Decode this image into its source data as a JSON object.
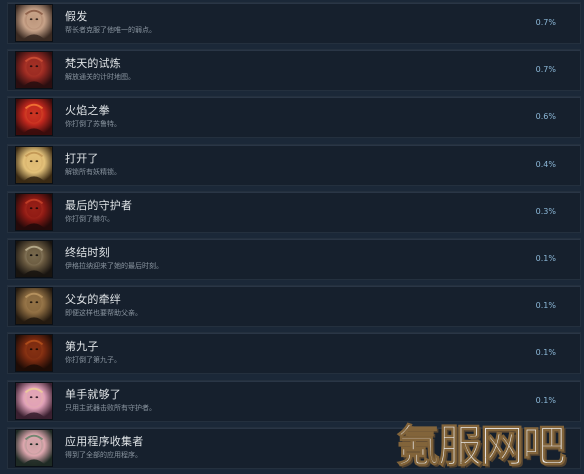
{
  "achievements": [
    {
      "title": "假发",
      "desc": "帮长者克服了他唯一的弱点。",
      "pct": "0.7%",
      "icon": "bald-skull-icon",
      "colors": [
        "#3a2a22",
        "#c9a48a",
        "#7a4a34"
      ]
    },
    {
      "title": "梵天的试炼",
      "desc": "解放通关的计时地图。",
      "pct": "0.7%",
      "icon": "red-demon-face-icon",
      "colors": [
        "#2a0e10",
        "#9a2a22",
        "#d9593a"
      ]
    },
    {
      "title": "火焰之拳",
      "desc": "你打倒了苏鲁特。",
      "pct": "0.6%",
      "icon": "fire-warrior-icon",
      "colors": [
        "#3a0c0c",
        "#c2281e",
        "#ff8a3a"
      ]
    },
    {
      "title": "打开了",
      "desc": "解锁所有妖精锁。",
      "pct": "0.4%",
      "icon": "blonde-elf-portrait-icon",
      "colors": [
        "#3a2a14",
        "#e4c27a",
        "#b88a4a"
      ]
    },
    {
      "title": "最后的守护者",
      "desc": "你打倒了赫尔。",
      "pct": "0.3%",
      "icon": "red-guardian-icon",
      "colors": [
        "#240a0a",
        "#8e1a14",
        "#d24a2e"
      ]
    },
    {
      "title": "终结时刻",
      "desc": "伊格拉纳迎来了她的最后时刻。",
      "pct": "0.1%",
      "icon": "horned-valkyrie-icon",
      "colors": [
        "#181410",
        "#6a5a40",
        "#cfc4a4"
      ]
    },
    {
      "title": "父女的牵绊",
      "desc": "即便这样也要帮助父亲。",
      "pct": "0.1%",
      "icon": "warrior-duo-icon",
      "colors": [
        "#241a10",
        "#8a6a40",
        "#c4a06a"
      ]
    },
    {
      "title": "第九子",
      "desc": "你打倒了第九子。",
      "pct": "0.1%",
      "icon": "crimson-beast-icon",
      "colors": [
        "#1e0c06",
        "#7a2a10",
        "#c0581e"
      ]
    },
    {
      "title": "单手就够了",
      "desc": "只用主武器击败所有守护者。",
      "pct": "0.1%",
      "icon": "pink-haired-girl-icon",
      "colors": [
        "#3a2030",
        "#e0a0b8",
        "#f0d890"
      ]
    },
    {
      "title": "应用程序收集者",
      "desc": "得到了全部的应用程序。",
      "pct": "",
      "icon": "pink-haired-elf-icon",
      "colors": [
        "#1e2a24",
        "#e0a8b0",
        "#4a7a5a"
      ]
    }
  ],
  "watermark": "氪服网吧"
}
